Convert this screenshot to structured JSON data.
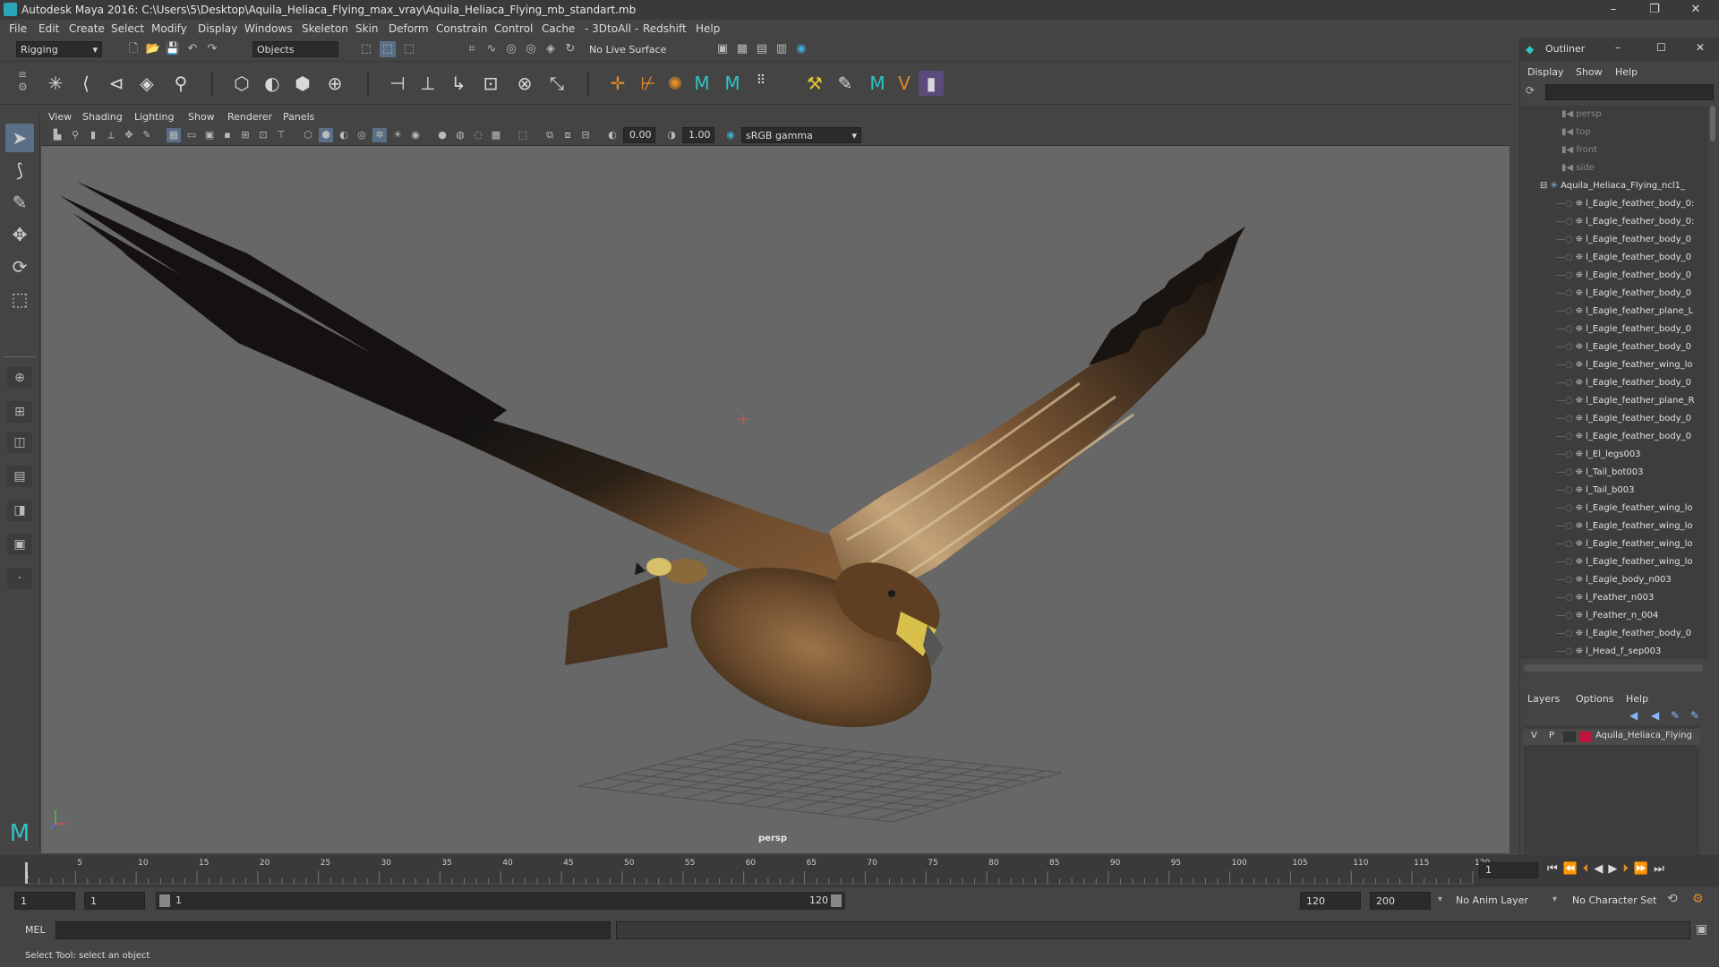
{
  "window": {
    "title": "Autodesk Maya 2016: C:\\Users\\5\\Desktop\\Aquila_Heliaca_Flying_max_vray\\Aquila_Heliaca_Flying_mb_standart.mb",
    "minimize": "–",
    "maximize": "❐",
    "close": "✕"
  },
  "menubar": [
    "File",
    "Edit",
    "Create",
    "Select",
    "Modify",
    "Display",
    "Windows",
    "Skeleton",
    "Skin",
    "Deform",
    "Constrain",
    "Control",
    "Cache",
    "- 3DtoAll -",
    "Redshift",
    "Help"
  ],
  "status": {
    "menuset": "Rigging",
    "selection_mode": "Objects",
    "live_surface": "No Live Surface"
  },
  "panel_menu": [
    "View",
    "Shading",
    "Lighting",
    "Show",
    "Renderer",
    "Panels"
  ],
  "panel_bar": {
    "value1": "0.00",
    "value2": "1.00",
    "colorspace": "sRGB gamma"
  },
  "viewport": {
    "camera_label": "persp"
  },
  "outliner": {
    "title": "Outliner",
    "menu": [
      "Display",
      "Show",
      "Help"
    ],
    "cameras": [
      "persp",
      "top",
      "front",
      "side"
    ],
    "root": "Aquila_Heliaca_Flying_ncl1_",
    "items": [
      "l_Eagle_feather_body_0:",
      "l_Eagle_feather_body_0:",
      "l_Eagle_feather_body_0",
      "l_Eagle_feather_body_0",
      "l_Eagle_feather_body_0",
      "l_Eagle_feather_body_0",
      "l_Eagle_feather_plane_L",
      "l_Eagle_feather_body_0",
      "l_Eagle_feather_body_0",
      "l_Eagle_feather_wing_lo",
      "l_Eagle_feather_body_0",
      "l_Eagle_feather_plane_R",
      "l_Eagle_feather_body_0",
      "l_Eagle_feather_body_0",
      "l_El_legs003",
      "l_Tail_bot003",
      "l_Tail_b003",
      "l_Eagle_feather_wing_lo",
      "l_Eagle_feather_wing_lo",
      "l_Eagle_feather_wing_lo",
      "l_Eagle_feather_wing_lo",
      "l_Eagle_body_n003",
      "l_Feather_n003",
      "l_Feather_n_004",
      "l_Eagle_feather_body_0",
      "l_Head_f_sep003"
    ]
  },
  "layers": {
    "menu": [
      "Layers",
      "Options",
      "Help"
    ],
    "layer": {
      "v": "V",
      "p": "P",
      "name": "Aquila_Heliaca_Flying",
      "color": "#c0143c"
    }
  },
  "timeline": {
    "ticks": [
      "5",
      "10",
      "15",
      "20",
      "25",
      "30",
      "35",
      "40",
      "45",
      "50",
      "55",
      "60",
      "65",
      "70",
      "75",
      "80",
      "85",
      "90",
      "95",
      "100",
      "105",
      "110",
      "115",
      "120"
    ],
    "start_label": "1",
    "current_frame": "1"
  },
  "range": {
    "start": "1",
    "anim_start": "1",
    "slider_start": "1",
    "slider_end": "120",
    "end": "120",
    "anim_end": "200",
    "anim_layer": "No Anim Layer",
    "char_set": "No Character Set"
  },
  "mel": {
    "label": "MEL"
  },
  "helpline": {
    "text": "Select Tool: select an object"
  },
  "colors": {
    "accent": "#5a6f86",
    "viewport_bg": "#676767",
    "layer_red": "#c0143c"
  }
}
